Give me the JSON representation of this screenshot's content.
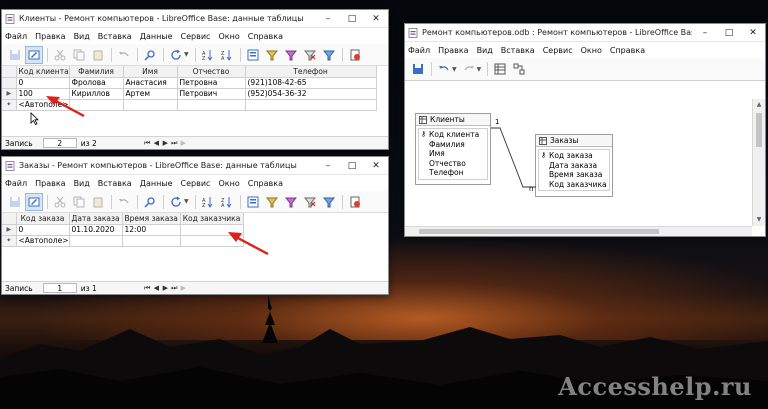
{
  "background": {
    "watermark": "Accesshelp.ru"
  },
  "colors": {
    "arrow": "#e0201b",
    "active_tool": "#d6e4f5",
    "titlebar": "#ffffff"
  },
  "window_clients": {
    "title": "Клиенты - Ремонт компьютеров - LibreOffice Base: данные таблицы",
    "menu": [
      "Файл",
      "Правка",
      "Вид",
      "Вставка",
      "Данные",
      "Сервис",
      "Окно",
      "Справка"
    ],
    "columns": [
      "Код клиента",
      "Фамилия",
      "Имя",
      "Отчество",
      "Телефон"
    ],
    "rows": [
      [
        "0",
        "Фролова",
        "Анастасия",
        "Петровна",
        "(921)108-42-65"
      ],
      [
        "100",
        "Кириллов",
        "Артем",
        "Петрович",
        "(952)054-36-32"
      ],
      [
        "<Автополе>",
        "",
        "",
        "",
        ""
      ]
    ],
    "nav": {
      "label": "Запись",
      "current": "2",
      "of": "из 2"
    }
  },
  "window_orders": {
    "title": "Заказы - Ремонт компьютеров - LibreOffice Base: данные таблицы",
    "menu": [
      "Файл",
      "Правка",
      "Вид",
      "Вставка",
      "Данные",
      "Сервис",
      "Окно",
      "Справка"
    ],
    "columns": [
      "Код заказа",
      "Дата заказа",
      "Время заказа",
      "Код заказчика"
    ],
    "rows": [
      [
        "0",
        "01.10.2020",
        "12:00",
        ""
      ],
      [
        "<Автополе>",
        "",
        "",
        ""
      ]
    ],
    "nav": {
      "label": "Запись",
      "current": "1",
      "of": "из 1"
    }
  },
  "window_relations": {
    "title": "Ремонт компьютеров.odb : Ремонт компьютеров - LibreOffice Base: конст...",
    "menu": [
      "Файл",
      "Правка",
      "Вид",
      "Вставка",
      "Сервис",
      "Окно",
      "Справка"
    ],
    "table1": {
      "name": "Клиенты",
      "fields": [
        "Код клиента",
        "Фамилия",
        "Имя",
        "Отчество",
        "Телефон"
      ]
    },
    "table2": {
      "name": "Заказы",
      "fields": [
        "Код заказа",
        "Дата заказа",
        "Время заказа",
        "Код заказчика"
      ]
    },
    "rel_one": "1",
    "rel_many": "n"
  },
  "icons": {
    "toolbar": [
      "save-icon",
      "edit-mode-icon",
      "cut-icon",
      "copy-icon",
      "paste-icon",
      "undo-icon",
      "find-icon",
      "refresh-icon",
      "sort-asc-icon",
      "sort-desc-icon",
      "form-view-icon",
      "autofilter-icon",
      "standard-filter-icon",
      "filter-off-icon",
      "advanced-filter-icon",
      "data-source-icon"
    ]
  }
}
